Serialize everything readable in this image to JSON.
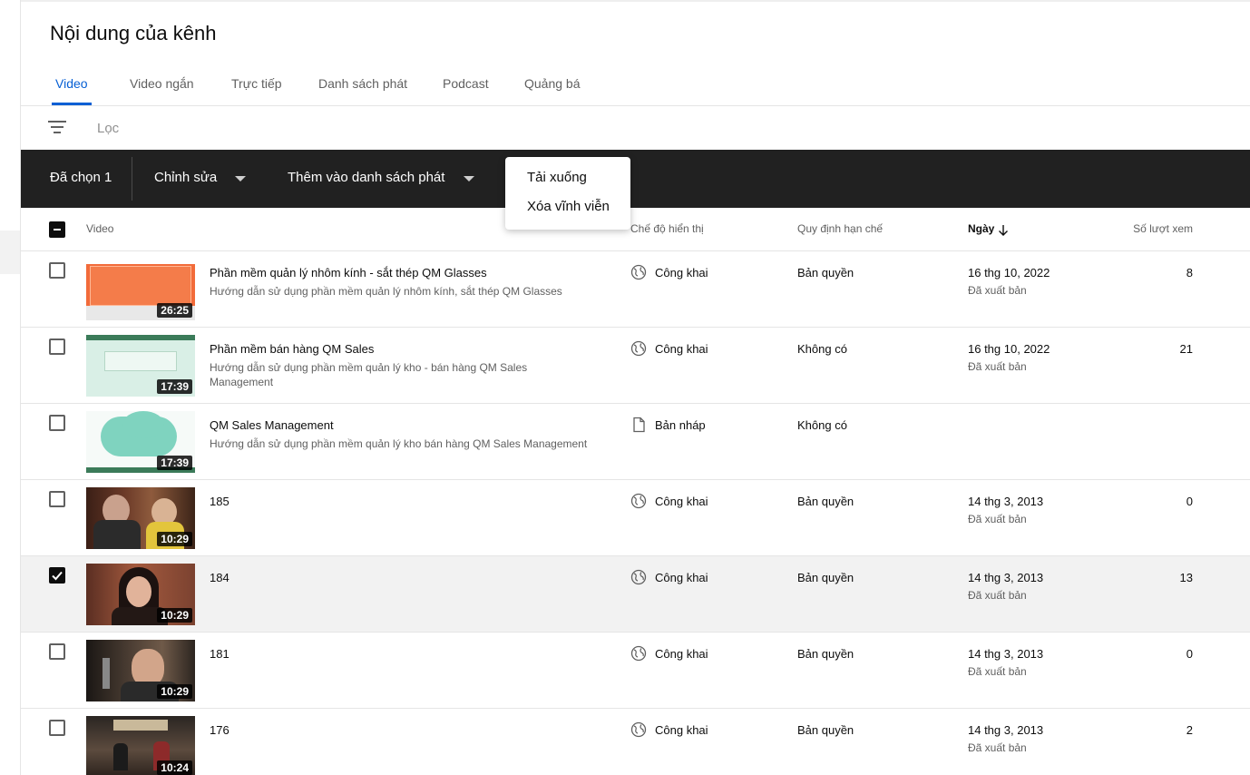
{
  "page": {
    "title": "Nội dung của kênh"
  },
  "tabs": [
    {
      "label": "Video",
      "active": true
    },
    {
      "label": "Video ngắn",
      "active": false
    },
    {
      "label": "Trực tiếp",
      "active": false
    },
    {
      "label": "Danh sách phát",
      "active": false
    },
    {
      "label": "Podcast",
      "active": false
    },
    {
      "label": "Quảng bá",
      "active": false
    }
  ],
  "filter": {
    "placeholder": "Lọc",
    "icon": "filter-icon"
  },
  "action_bar": {
    "selected_label": "Đã chọn 1",
    "edit_label": "Chỉnh sửa",
    "add_to_playlist_label": "Thêm vào danh sách phát"
  },
  "more_menu": {
    "items": [
      "Tải xuống",
      "Xóa vĩnh viễn"
    ]
  },
  "table": {
    "headers": {
      "video": "Video",
      "visibility": "Chế độ hiển thị",
      "restrictions": "Quy định hạn chế",
      "date": "Ngày",
      "views": "Số lượt xem"
    },
    "sort_column": "date",
    "sort_direction": "descending",
    "rows": [
      {
        "selected": false,
        "duration": "26:25",
        "title": "Phần mềm quản lý nhôm kính - sắt thép QM Glasses",
        "description": "Hướng dẫn sử dụng phần mềm quản lý nhôm kính, sắt thép QM Glasses",
        "visibility": "Công khai",
        "visibility_icon": "globe-icon",
        "restrictions": "Bản quyền",
        "date": "16 thg 10, 2022",
        "status": "Đã xuất bản",
        "views": "8"
      },
      {
        "selected": false,
        "duration": "17:39",
        "title": "Phần mềm bán hàng QM Sales",
        "description": "Hướng dẫn sử dụng phần mềm quản lý kho - bán hàng QM Sales Management",
        "visibility": "Công khai",
        "visibility_icon": "globe-icon",
        "restrictions": "Không có",
        "date": "16 thg 10, 2022",
        "status": "Đã xuất bản",
        "views": "21"
      },
      {
        "selected": false,
        "duration": "17:39",
        "title": "QM Sales Management",
        "description": "Hướng dẫn sử dụng phần mềm quản lý kho bán hàng QM Sales Management",
        "visibility": "Bản nháp",
        "visibility_icon": "draft-icon",
        "restrictions": "Không có",
        "date": "",
        "status": "",
        "views": ""
      },
      {
        "selected": false,
        "duration": "10:29",
        "title": "185",
        "description": "",
        "visibility": "Công khai",
        "visibility_icon": "globe-icon",
        "restrictions": "Bản quyền",
        "date": "14 thg 3, 2013",
        "status": "Đã xuất bản",
        "views": "0"
      },
      {
        "selected": true,
        "duration": "10:29",
        "title": "184",
        "description": "",
        "visibility": "Công khai",
        "visibility_icon": "globe-icon",
        "restrictions": "Bản quyền",
        "date": "14 thg 3, 2013",
        "status": "Đã xuất bản",
        "views": "13"
      },
      {
        "selected": false,
        "duration": "10:29",
        "title": "181",
        "description": "",
        "visibility": "Công khai",
        "visibility_icon": "globe-icon",
        "restrictions": "Bản quyền",
        "date": "14 thg 3, 2013",
        "status": "Đã xuất bản",
        "views": "0"
      },
      {
        "selected": false,
        "duration": "10:24",
        "title": "176",
        "description": "",
        "visibility": "Công khai",
        "visibility_icon": "globe-icon",
        "restrictions": "Bản quyền",
        "date": "14 thg 3, 2013",
        "status": "Đã xuất bản",
        "views": "2"
      }
    ]
  },
  "colors": {
    "accent": "#065fd4",
    "action_bar": "#212121",
    "selected_row": "#f2f2f2"
  }
}
